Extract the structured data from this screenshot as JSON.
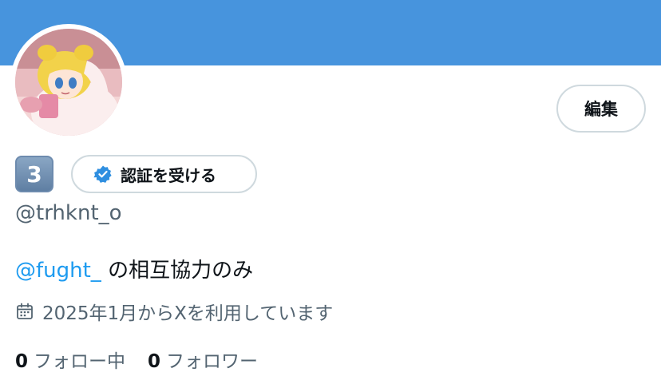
{
  "profile": {
    "handle": "@trhknt_o",
    "emoji_badge": "3",
    "avatar": "anime-character-avatar"
  },
  "buttons": {
    "edit_label": "編集",
    "verify_label": "認証を受ける"
  },
  "bio": {
    "mention": "@fught_",
    "text": " の相互協力のみ"
  },
  "joined": {
    "icon": "calendar-icon",
    "text": "2025年1月からXを利用しています"
  },
  "stats": {
    "following_count": "0",
    "following_label": "フォロー中",
    "followers_count": "0",
    "followers_label": "フォロワー"
  },
  "colors": {
    "banner": "#4794dd",
    "accent": "#1d9bf0",
    "secondary_text": "#536471",
    "verified_badge": "#2f8fe0"
  }
}
